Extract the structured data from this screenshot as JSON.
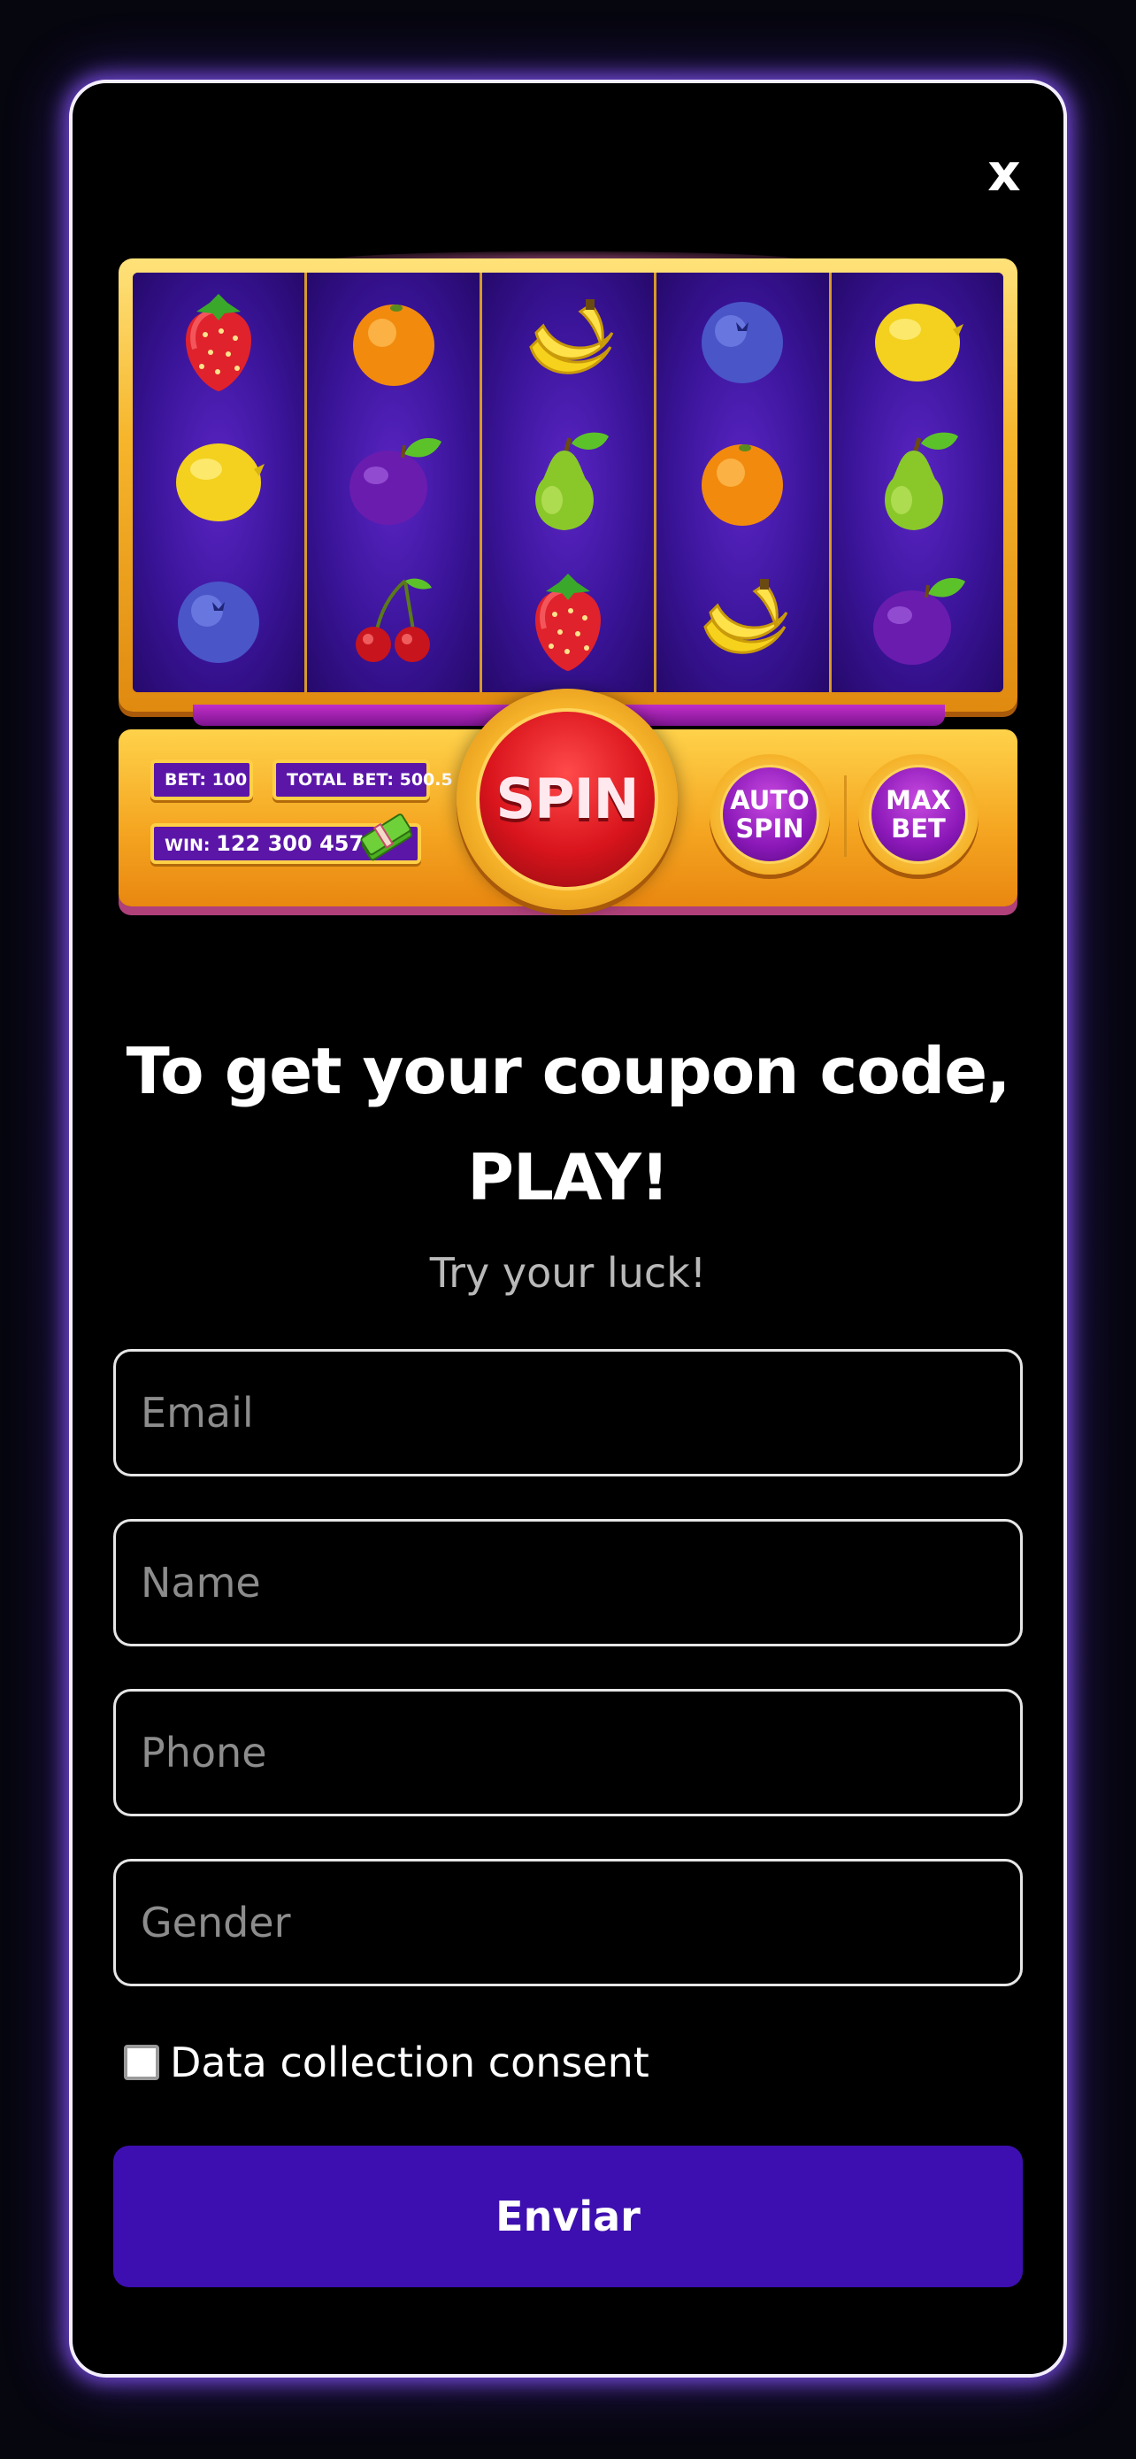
{
  "modal": {
    "close_label": "x"
  },
  "slot_machine": {
    "reels": [
      [
        "strawberry",
        "lemon",
        "blueberry"
      ],
      [
        "orange",
        "plum",
        "cherry"
      ],
      [
        "banana",
        "pear",
        "strawberry"
      ],
      [
        "blueberry",
        "orange",
        "banana"
      ],
      [
        "lemon",
        "pear",
        "plum"
      ]
    ],
    "bet_label": "BET: 100",
    "total_bet_label": "TOTAL BET: 500.5",
    "win_prefix": "WIN:",
    "win_value": "122 300 457",
    "spin_label": "SPIN",
    "auto_spin_line1": "AUTO",
    "auto_spin_line2": "SPIN",
    "max_bet_line1": "MAX",
    "max_bet_line2": "BET"
  },
  "headline": {
    "line1": "To get your coupon code,",
    "line2": "PLAY!"
  },
  "subheadline": "Try your luck!",
  "form": {
    "email_placeholder": "Email",
    "name_placeholder": "Name",
    "phone_placeholder": "Phone",
    "gender_placeholder": "Gender",
    "consent_label": "Data collection consent",
    "consent_checked": false,
    "submit_label": "Enviar"
  },
  "colors": {
    "modal_glow": "#8c5aff",
    "submit_bg": "#3d0fb0",
    "reel_bg": "#3a1499",
    "gold": "#f5b229",
    "spin_red": "#d9141c"
  }
}
